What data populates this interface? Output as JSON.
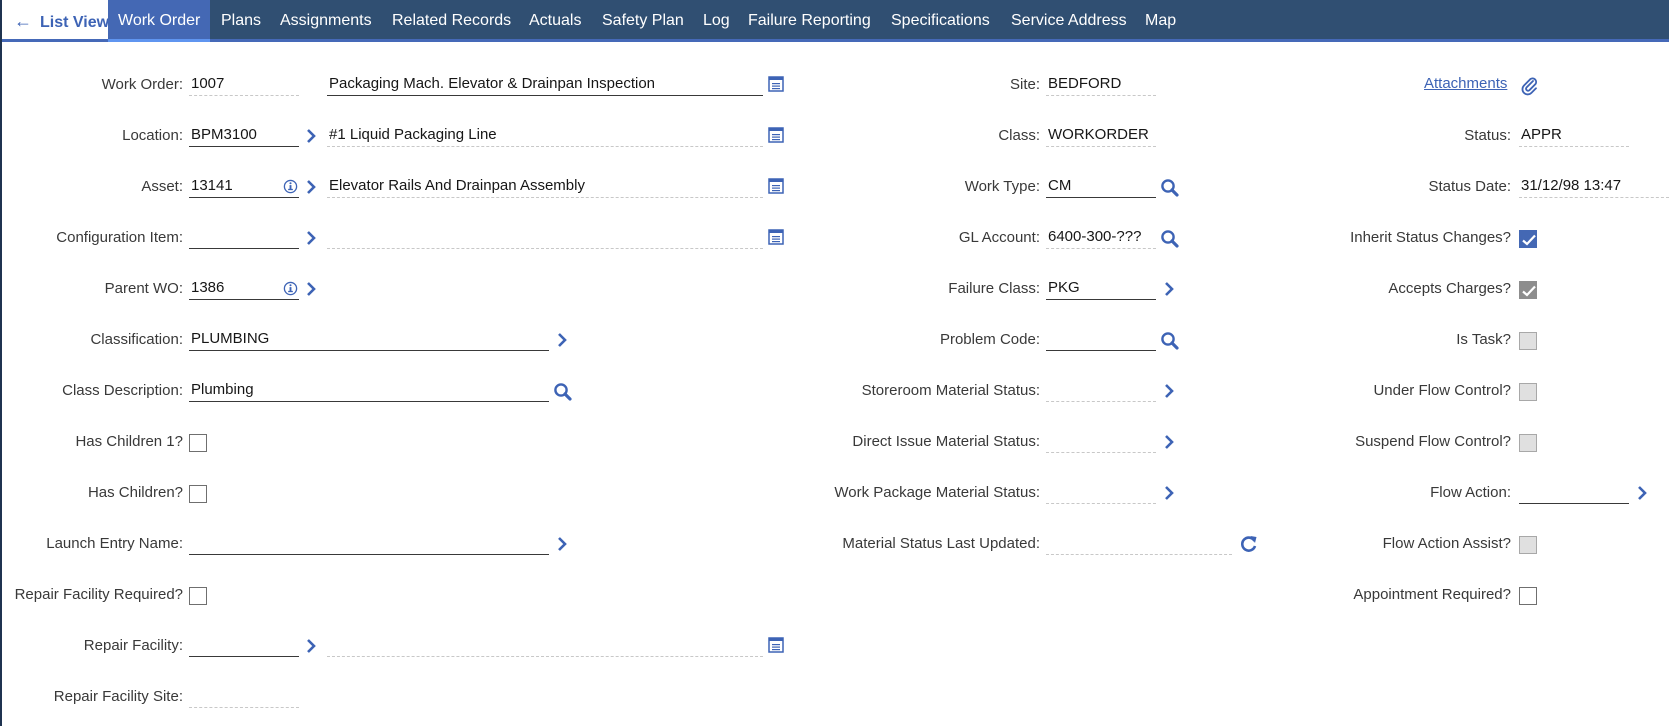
{
  "tabs": {
    "back_label": "List View",
    "items": [
      "Work Order",
      "Plans",
      "Assignments",
      "Related Records",
      "Actuals",
      "Safety Plan",
      "Log",
      "Failure Reporting",
      "Specifications",
      "Service Address",
      "Map"
    ],
    "active": "Work Order"
  },
  "colors": {
    "nav_bg": "#304f72",
    "accent": "#4468b4",
    "link": "#3d63b5"
  },
  "col1": {
    "work_order": {
      "label": "Work Order:",
      "value": "1007",
      "description": "Packaging Mach. Elevator & Drainpan Inspection"
    },
    "location": {
      "label": "Location:",
      "value": "BPM3100",
      "description": "#1 Liquid Packaging Line"
    },
    "asset": {
      "label": "Asset:",
      "value": "13141",
      "description": "Elevator Rails And Drainpan Assembly"
    },
    "config_item": {
      "label": "Configuration Item:",
      "value": "",
      "description": ""
    },
    "parent_wo": {
      "label": "Parent WO:",
      "value": "1386"
    },
    "classification": {
      "label": "Classification:",
      "value": "PLUMBING"
    },
    "class_description": {
      "label": "Class Description:",
      "value": "Plumbing"
    },
    "has_children_1": {
      "label": "Has Children 1?",
      "checked": false
    },
    "has_children": {
      "label": "Has Children?",
      "checked": false
    },
    "launch_entry_name": {
      "label": "Launch Entry Name:",
      "value": ""
    },
    "repair_facility_required": {
      "label": "Repair Facility Required?",
      "checked": false
    },
    "repair_facility": {
      "label": "Repair Facility:",
      "value": "",
      "description": ""
    },
    "repair_facility_site": {
      "label": "Repair Facility Site:",
      "value": ""
    }
  },
  "col2": {
    "site": {
      "label": "Site:",
      "value": "BEDFORD"
    },
    "class": {
      "label": "Class:",
      "value": "WORKORDER"
    },
    "work_type": {
      "label": "Work Type:",
      "value": "CM"
    },
    "gl_account": {
      "label": "GL Account:",
      "value": "6400-300-???"
    },
    "failure_class": {
      "label": "Failure Class:",
      "value": "PKG"
    },
    "problem_code": {
      "label": "Problem Code:",
      "value": ""
    },
    "storeroom_material_status": {
      "label": "Storeroom Material Status:",
      "value": ""
    },
    "direct_issue_material_status": {
      "label": "Direct Issue Material Status:",
      "value": ""
    },
    "work_package_material_status": {
      "label": "Work Package Material Status:",
      "value": ""
    },
    "material_status_last_updated": {
      "label": "Material Status Last Updated:",
      "value": ""
    }
  },
  "col3": {
    "attachments_label": "Attachments",
    "status": {
      "label": "Status:",
      "value": "APPR"
    },
    "status_date": {
      "label": "Status Date:",
      "value": "31/12/98 13:47"
    },
    "inherit_status_changes": {
      "label": "Inherit Status Changes?",
      "checked": true
    },
    "accepts_charges": {
      "label": "Accepts Charges?",
      "checked": true,
      "readonly": true
    },
    "is_task": {
      "label": "Is Task?",
      "checked": false,
      "readonly": true
    },
    "under_flow_control": {
      "label": "Under Flow Control?",
      "checked": false,
      "readonly": true
    },
    "suspend_flow_control": {
      "label": "Suspend Flow Control?",
      "checked": false,
      "readonly": true
    },
    "flow_action": {
      "label": "Flow Action:",
      "value": ""
    },
    "flow_action_assist": {
      "label": "Flow Action Assist?",
      "checked": false,
      "readonly": true
    },
    "appointment_required": {
      "label": "Appointment Required?",
      "checked": false
    }
  }
}
